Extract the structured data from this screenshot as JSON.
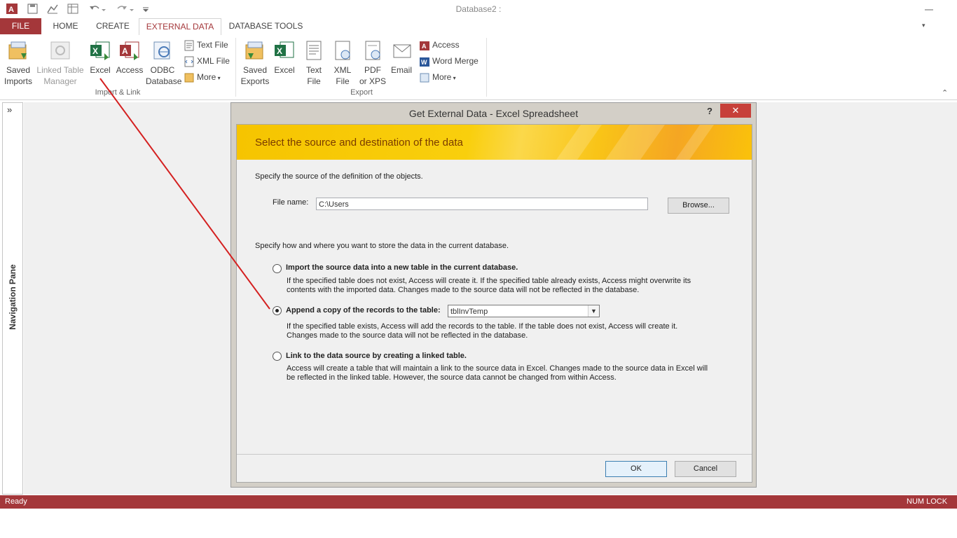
{
  "window": {
    "title": "Database2 :"
  },
  "tabs": [
    {
      "label": "FILE"
    },
    {
      "label": "HOME"
    },
    {
      "label": "CREATE"
    },
    {
      "label": "EXTERNAL DATA"
    },
    {
      "label": "DATABASE TOOLS"
    }
  ],
  "ribbon": {
    "import_group": {
      "label": "Import & Link",
      "saved_imports": "Saved\nImports",
      "linked_table_manager": "Linked Table\nManager",
      "excel": "Excel",
      "access": "Access",
      "odbc": "ODBC\nDatabase",
      "text_file": "Text File",
      "xml_file": "XML File",
      "more": "More"
    },
    "export_group": {
      "label": "Export",
      "saved_exports": "Saved\nExports",
      "excel": "Excel",
      "text_file": "Text\nFile",
      "xml_file": "XML\nFile",
      "pdf": "PDF\nor XPS",
      "email": "Email",
      "access": "Access",
      "word_merge": "Word Merge",
      "more": "More"
    }
  },
  "nav_pane": {
    "label": "Navigation Pane",
    "toggle": "»"
  },
  "dialog": {
    "title": "Get External Data - Excel Spreadsheet",
    "help": "?",
    "close": "✕",
    "banner": "Select the source and destination of the data",
    "source_intro": "Specify the source of the definition of the objects.",
    "file_label": "File name:",
    "file_value": "C:\\Users",
    "browse": "Browse...",
    "store_intro": "Specify how and where you want to store the data in the current database.",
    "options": [
      {
        "label": "Import the source data into a new table in the current database.",
        "desc1": "If the specified table does not exist, Access will create it. If the specified table already exists, Access might overwrite its",
        "desc2": "contents with the imported data. Changes made to the source data will not be reflected in the database.",
        "checked": false
      },
      {
        "label": "Append a copy of the records to the table:",
        "desc1": "If the specified table exists, Access will add the records to the table. If the table does not exist, Access will create it.",
        "desc2": "Changes made to the source data will not be reflected in the database.",
        "checked": true
      },
      {
        "label": "Link to the data source by creating a linked table.",
        "desc1": "Access will create a table that will maintain a link to the source data in Excel. Changes made to the source data in Excel will",
        "desc2": "be reflected in the linked table. However, the source data cannot be changed from within Access.",
        "checked": false
      }
    ],
    "table_select": "tblInvTemp",
    "ok": "OK",
    "cancel": "Cancel"
  },
  "status": {
    "left": "Ready",
    "right": "NUM LOCK"
  },
  "colors": {
    "access_red": "#a4373a",
    "banner_yellow": "#f9cf0d",
    "annotation_red": "#d42020"
  }
}
